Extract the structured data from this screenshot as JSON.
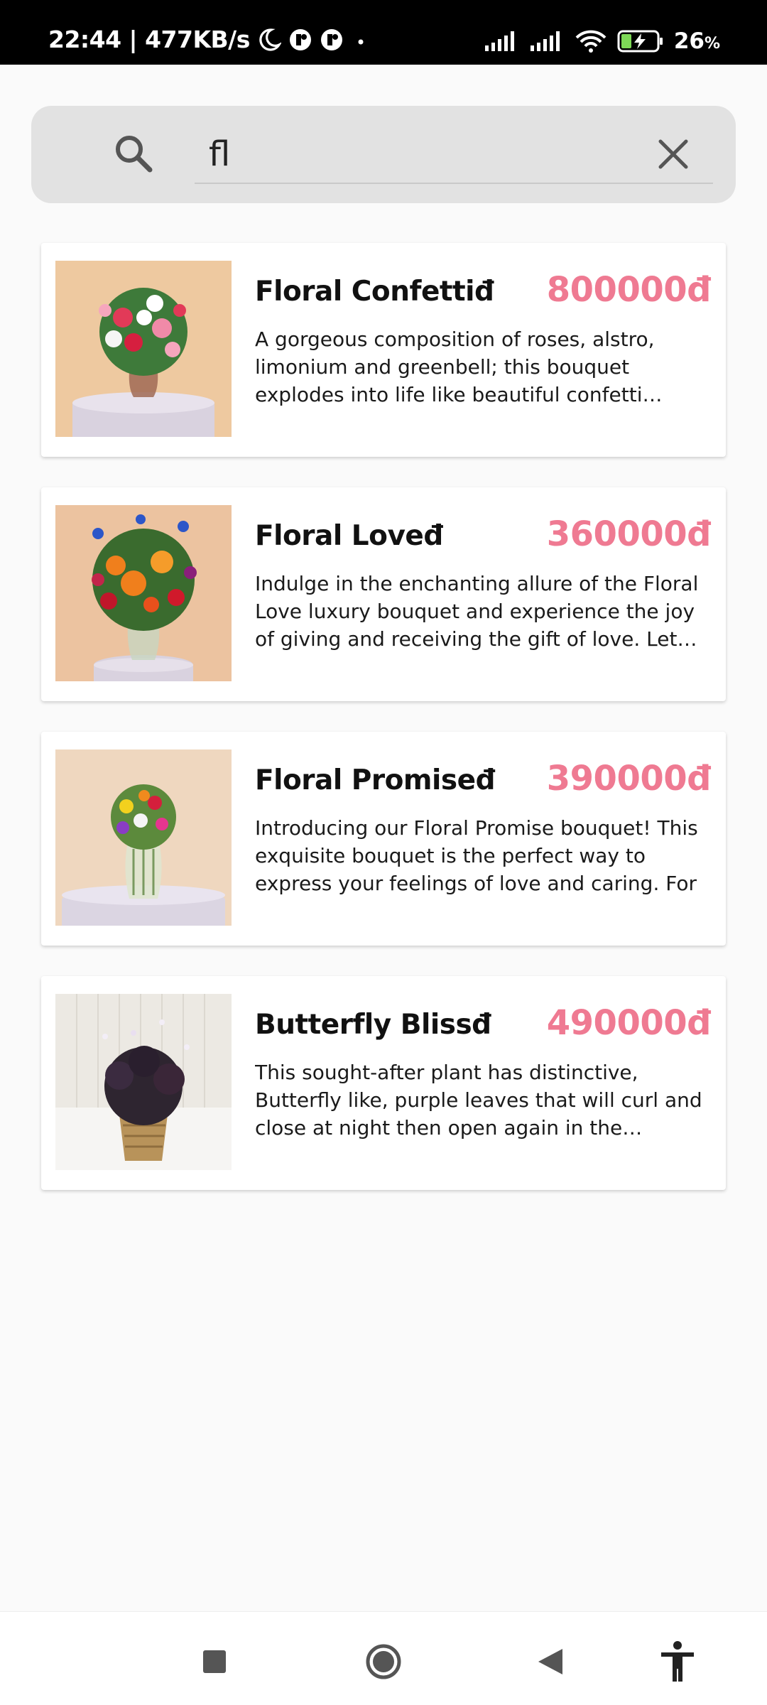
{
  "status_bar": {
    "time_speed": "22:44 | 477KB/s",
    "battery_level": "26",
    "battery_unit": "%"
  },
  "search": {
    "query": "fl"
  },
  "products": [
    {
      "title": "Floral Confettiđ",
      "price": "800000đ",
      "description": "A gorgeous composition of roses, alstro, limonium and greenbell; this bouquet explodes into life like beautiful confetti cannons"
    },
    {
      "title": "Floral Loveđ",
      "price": "360000đ",
      "description": "Indulge in the enchanting allure of the Floral Love luxury bouquet and experience the joy of giving and receiving the gift of love. Let this"
    },
    {
      "title": "Floral Promiseđ",
      "price": "390000đ",
      "description": "Introducing our Floral Promise bouquet! This exquisite bouquet is the perfect way to express your feelings of love and caring. For"
    },
    {
      "title": "Butterfly Blissđ",
      "price": "490000đ",
      "description": "This sought-after plant has distinctive, Butterfly like, purple leaves that will curl and close at night then open again in the morning"
    }
  ],
  "colors": {
    "price": "#ef7a92",
    "search_bg": "#e2e2e2",
    "background": "#fafafa"
  },
  "icons": {
    "search": "search-icon",
    "clear": "close-icon",
    "nav_recents": "square-icon",
    "nav_home": "circle-icon",
    "nav_back": "back-triangle-icon",
    "accessibility": "accessibility-icon"
  }
}
